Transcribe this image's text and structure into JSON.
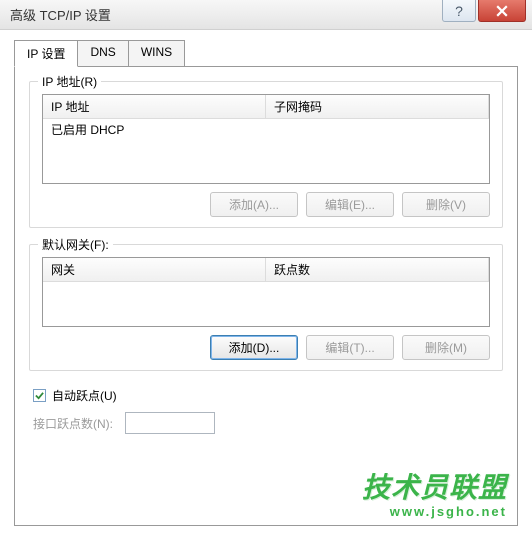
{
  "title": "高级 TCP/IP 设置",
  "tabs": [
    {
      "label": "IP 设置"
    },
    {
      "label": "DNS"
    },
    {
      "label": "WINS"
    }
  ],
  "group_ip": {
    "title": "IP 地址(R)",
    "col1": "IP 地址",
    "col2": "子网掩码",
    "row1": "已启用 DHCP",
    "btn_add": "添加(A)...",
    "btn_edit": "编辑(E)...",
    "btn_del": "删除(V)"
  },
  "group_gw": {
    "title": "默认网关(F):",
    "col1": "网关",
    "col2": "跃点数",
    "btn_add": "添加(D)...",
    "btn_edit": "编辑(T)...",
    "btn_del": "删除(M)"
  },
  "auto_metric_label": "自动跃点(U)",
  "auto_metric_checked": true,
  "iface_metric_label": "接口跃点数(N):",
  "watermark": {
    "main": "技术员联盟",
    "sub": "www.jsgho.net"
  }
}
